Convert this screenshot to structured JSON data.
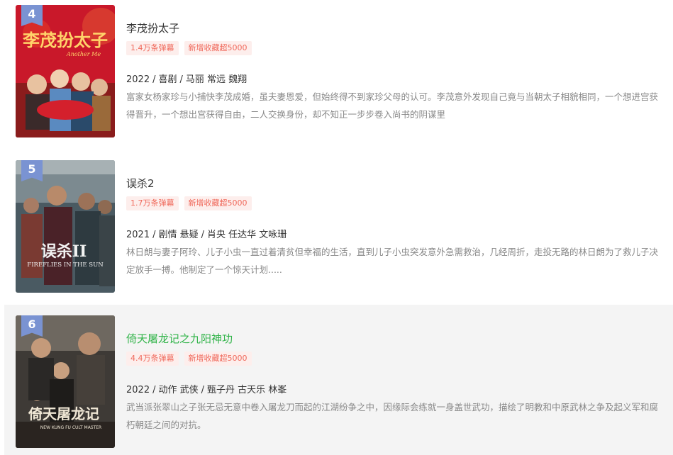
{
  "rank_badge_color": "#7a93d2",
  "active_title_color": "#32b44a",
  "tag_text_color": "#f06a5c",
  "tag_bg_color": "#fdeeec",
  "items": [
    {
      "rank": "4",
      "title": "李茂扮太子",
      "poster_text": "李茂扮太子",
      "poster_subtext": "Another Me",
      "tag_danmaku": "1.4万条弹幕",
      "tag_fav": "新增收藏超5000",
      "year": "2022",
      "genres": "喜剧",
      "cast": "马丽 常远 魏翔",
      "description": "富家女杨家珍与小捕快李茂成婚，虽夫妻恩爱，但始终得不到家珍父母的认可。李茂意外发现自己竟与当朝太子相貌相同，一个想进宫获得晋升，一个想出宫获得自由，二人交换身份，却不知正一步步卷入尚书的阴谋里"
    },
    {
      "rank": "5",
      "title": "误杀2",
      "poster_text": "误杀II",
      "poster_subtext": "FIREFLIES IN THE SUN",
      "tag_danmaku": "1.7万条弹幕",
      "tag_fav": "新增收藏超5000",
      "year": "2021",
      "genres": "剧情 悬疑",
      "cast": "肖央 任达华 文咏珊",
      "description": "林日朗与妻子阿玲、儿子小虫一直过着清贫但幸福的生活，直到儿子小虫突发意外急需救治，几经周折，走投无路的林日朗为了救儿子决定放手一搏。他制定了一个惊天计划....."
    },
    {
      "rank": "6",
      "title": "倚天屠龙记之九阳神功",
      "poster_text": "倚天屠龙记",
      "poster_subtext": "NEW KUNG FU CULT MASTER",
      "tag_danmaku": "4.4万条弹幕",
      "tag_fav": "新增收藏超5000",
      "year": "2022",
      "genres": "动作 武侠",
      "cast": "甄子丹 古天乐 林峯",
      "description": "武当派张翠山之子张无忌无意中卷入屠龙刀而起的江湖纷争之中，因缘际会练就一身盖世武功，描绘了明教和中原武林之争及起义军和腐朽朝廷之间的对抗。"
    }
  ]
}
